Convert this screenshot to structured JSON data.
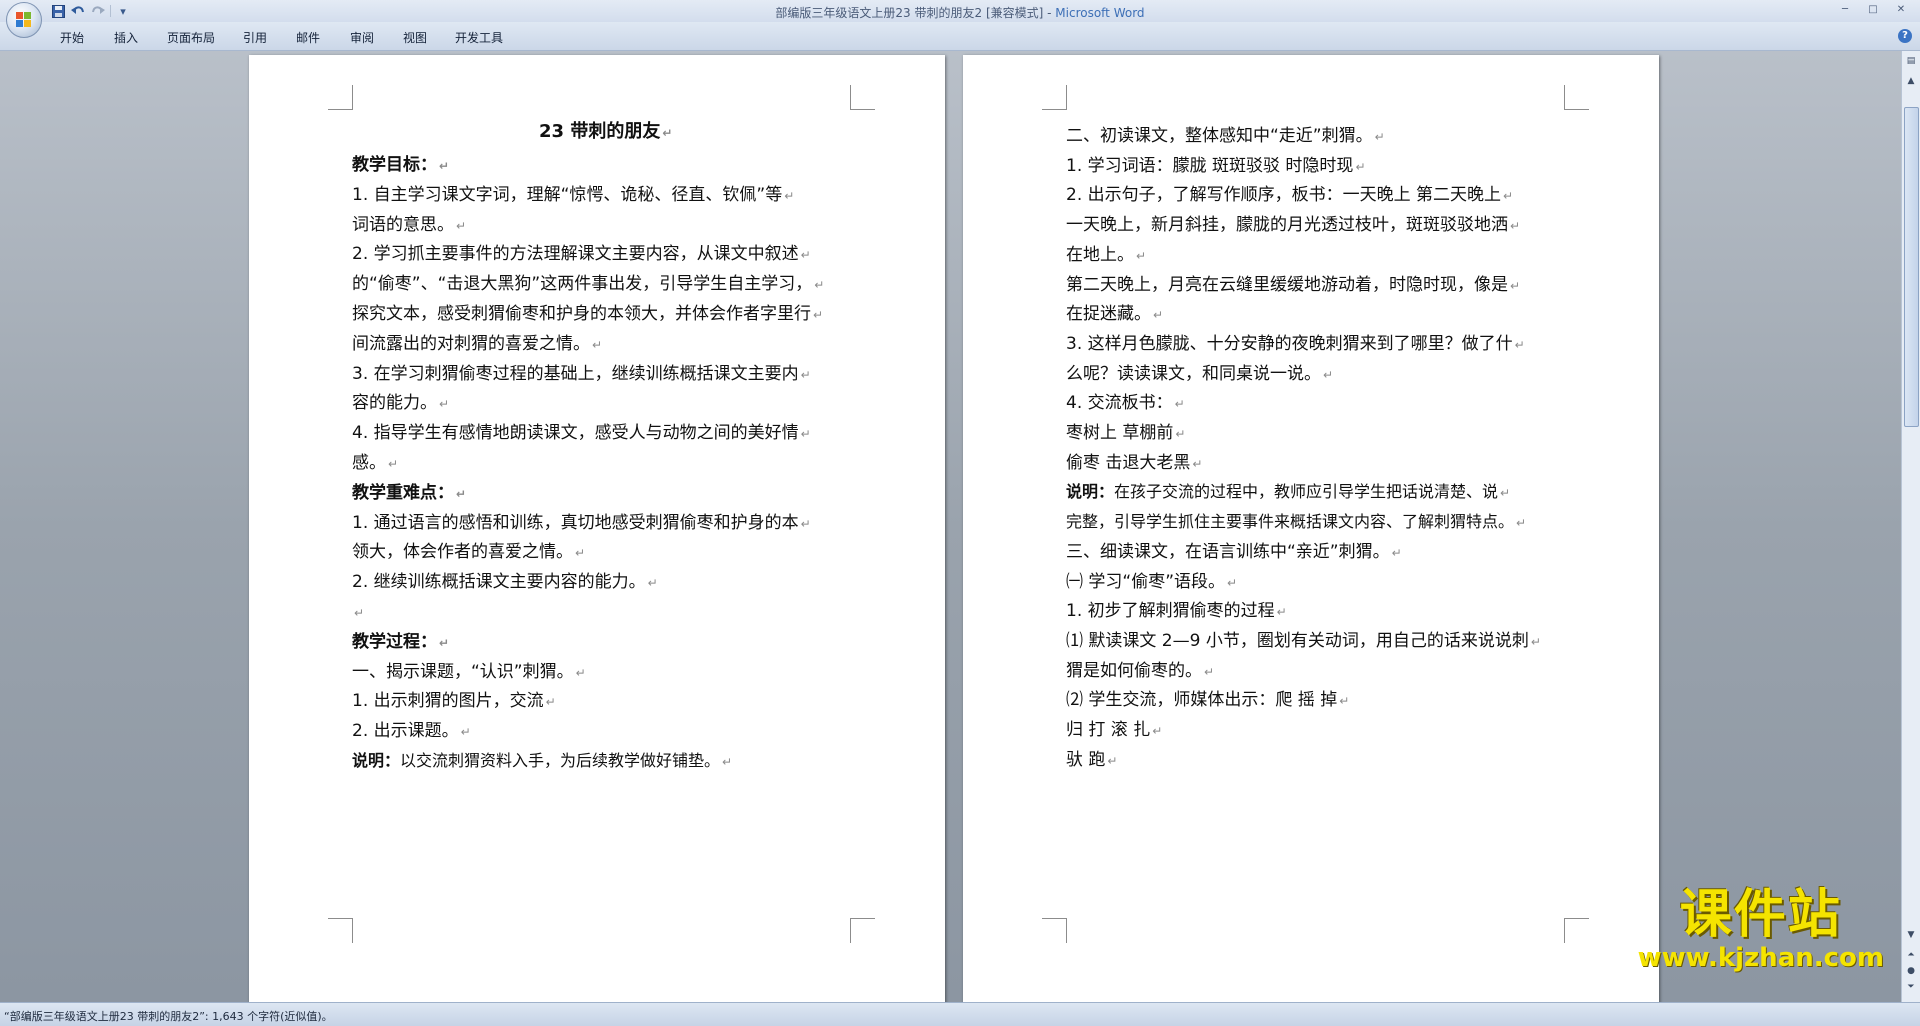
{
  "window": {
    "title": "部编版三年级语文上册23 带刺的朋友2 [兼容模式] - ",
    "app_name": "Microsoft Word"
  },
  "qat": {
    "save_icon": "save-icon",
    "undo_icon": "undo-icon",
    "redo_icon": "redo-icon",
    "more": "▾"
  },
  "ribbon": {
    "tabs": [
      "开始",
      "插入",
      "页面布局",
      "引用",
      "邮件",
      "审阅",
      "视图",
      "开发工具"
    ],
    "help": "?"
  },
  "page_left": {
    "title": "23 带刺的朋友",
    "lines": [
      "教学目标：",
      " 1. 自主学习课文字词，理解“惊愕、诡秘、径直、钦佩”等",
      "词语的意思。",
      " 2. 学习抓主要事件的方法理解课文主要内容，从课文中叙述",
      "的“偷枣”、“击退大黑狗”这两件事出发，引导学生自主学习，",
      "探究文本，感受刺猬偷枣和护身的本领大，并体会作者字里行",
      "间流露出的对刺猬的喜爱之情。",
      " 3. 在学习刺猬偷枣过程的基础上，继续训练概括课文主要内",
      "容的能力。",
      " 4. 指导学生有感情地朗读课文，感受人与动物之间的美好情",
      "感。",
      "教学重难点：",
      " 1. 通过语言的感悟和训练，真切地感受刺猬偷枣和护身的本",
      "领大，体会作者的喜爱之情。",
      " 2. 继续训练概括课文主要内容的能力。",
      "",
      "教学过程：",
      "一、揭示课题，“认识”刺猬。",
      " 1. 出示刺猬的图片，交流",
      " 2. 出示课题。",
      "说明：以交流刺猬资料入手，为后续教学做好铺垫。"
    ]
  },
  "page_right": {
    "lines": [
      "二、初读课文，整体感知中“走近”刺猬。",
      " 1. 学习词语：朦胧  斑斑驳驳 时隐时现",
      " 2. 出示句子，了解写作顺序，板书：一天晚上    第二天晚上",
      "   一天晚上，新月斜挂，朦胧的月光透过枝叶，斑斑驳驳地洒",
      "在地上。",
      "   第二天晚上，月亮在云缝里缓缓地游动着，时隐时现，像是",
      "在捉迷藏。",
      " 3. 这样月色朦胧、十分安静的夜晚刺猬来到了哪里？做了什",
      "么呢？读读课文，和同桌说一说。",
      " 4. 交流板书：",
      "                 枣树上                          草棚前",
      "                   偷枣                       击退大老黑",
      "说明：在孩子交流的过程中，教师应引导学生把话说清楚、说",
      "完整，引导学生抓住主要事件来概括课文内容、了解刺猬特点。",
      "三、细读课文，在语言训练中“亲近”刺猬。",
      "㈠  学习“偷枣”语段。",
      " 1. 初步了解刺猬偷枣的过程",
      "⑴ 默读课文 2—9 小节，圈划有关动词，用自己的话来说说刺",
      "猬是如何偷枣的。",
      "⑵ 学生交流，师媒体出示：爬     摇      掉",
      "                                          归     打 滚     扎",
      "                                          驮     跑"
    ]
  },
  "status": {
    "text": "“部编版三年级语文上册23 带刺的朋友2”: 1,643 个字符(近似值)。"
  },
  "watermark": {
    "main": "课件站",
    "url": "www.kjzhan.com"
  }
}
